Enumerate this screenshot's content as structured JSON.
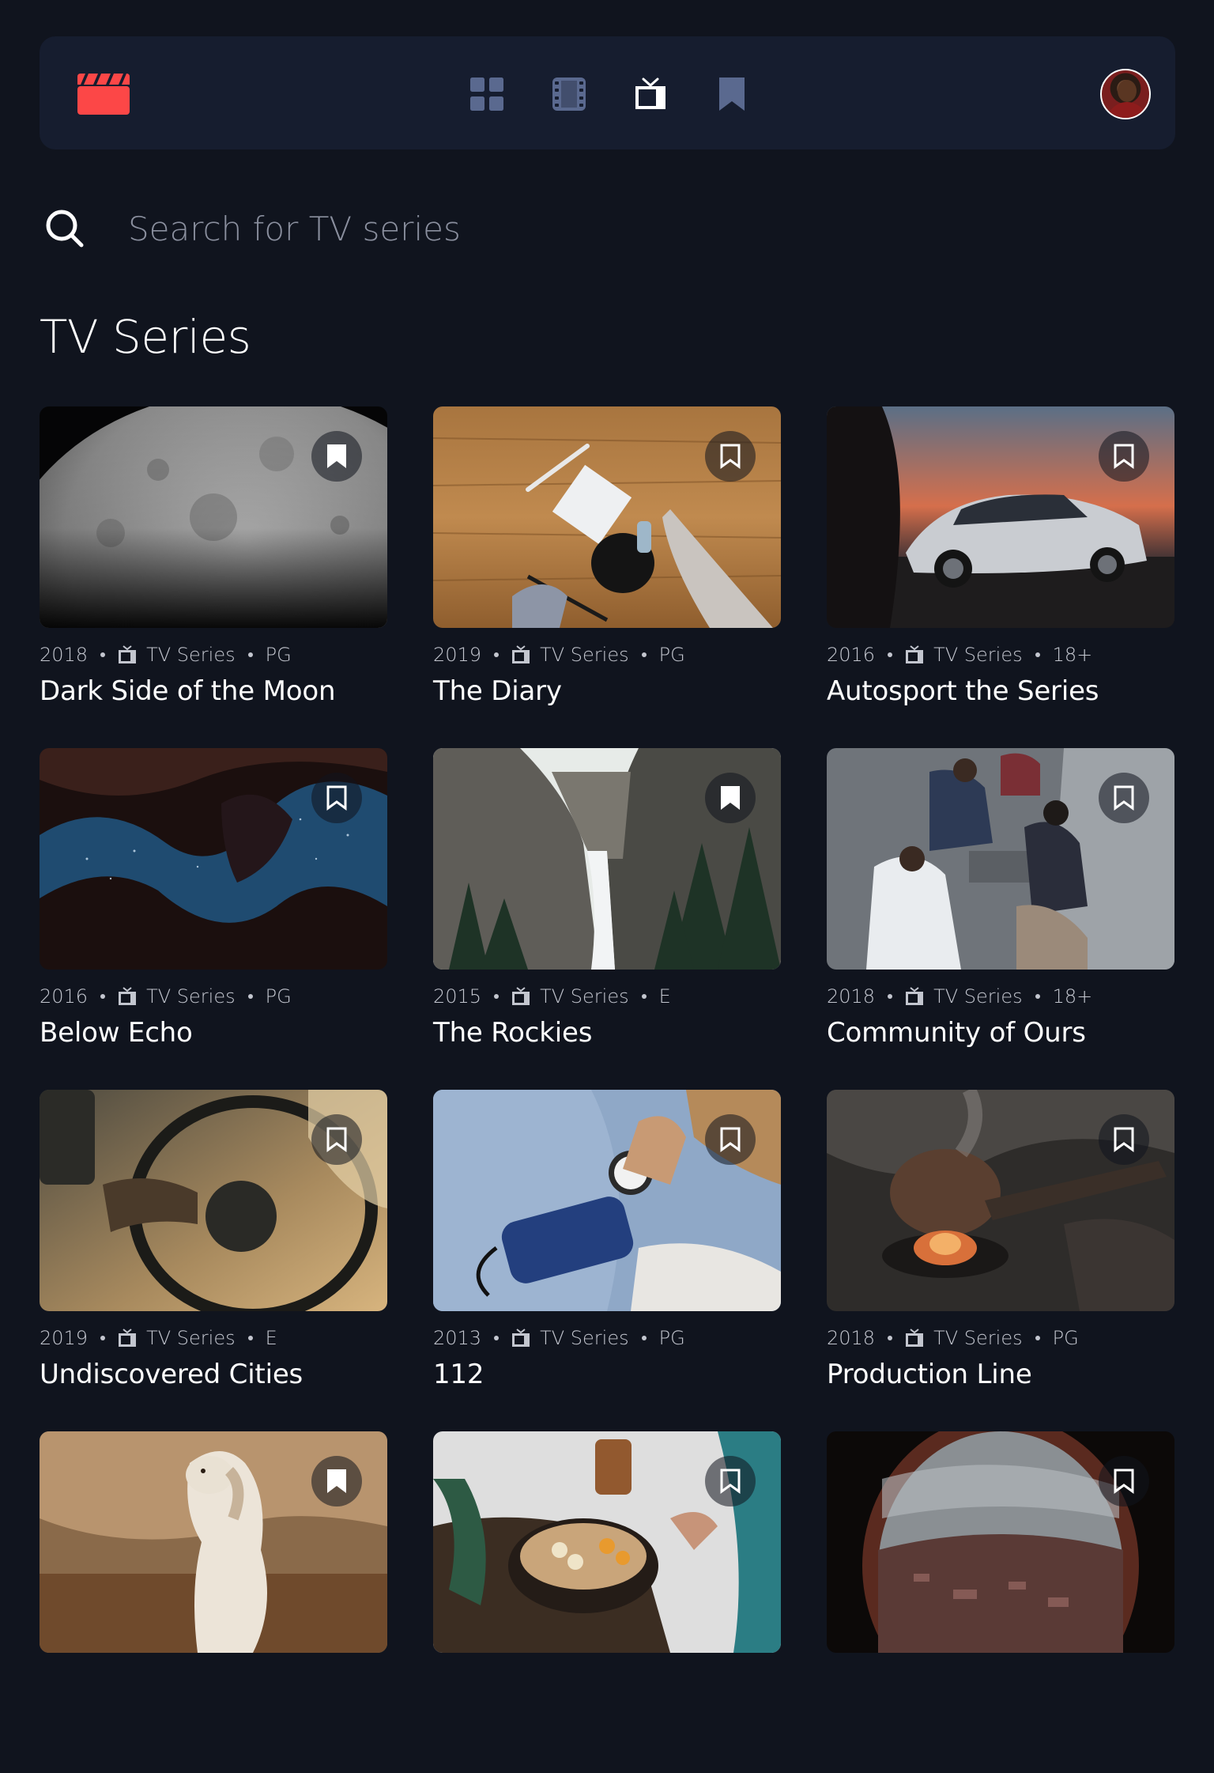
{
  "colors": {
    "background": "#10141e",
    "nav_background": "#161d2f",
    "accent_red": "#fc4747",
    "nav_icon_inactive": "#5a698f",
    "nav_icon_active": "#ffffff",
    "muted_text": "#c3c6cf"
  },
  "nav": {
    "logo_icon": "clapperboard-icon",
    "items": [
      {
        "name": "home",
        "icon": "grid-icon",
        "active": false
      },
      {
        "name": "movies",
        "icon": "film-icon",
        "active": false
      },
      {
        "name": "tv-series",
        "icon": "tv-icon",
        "active": true
      },
      {
        "name": "bookmarks",
        "icon": "bookmark-icon",
        "active": false
      }
    ],
    "avatar_icon": "user-avatar"
  },
  "search": {
    "icon": "search-icon",
    "placeholder": "Search for TV series",
    "value": ""
  },
  "page_title": "TV Series",
  "items": [
    {
      "year": "2018",
      "category": "TV Series",
      "rating": "PG",
      "title": "Dark Side of the Moon",
      "bookmarked": true
    },
    {
      "year": "2019",
      "category": "TV Series",
      "rating": "PG",
      "title": "The Diary",
      "bookmarked": false
    },
    {
      "year": "2016",
      "category": "TV Series",
      "rating": "18+",
      "title": "Autosport the Series",
      "bookmarked": false
    },
    {
      "year": "2016",
      "category": "TV Series",
      "rating": "PG",
      "title": "Below Echo",
      "bookmarked": false
    },
    {
      "year": "2015",
      "category": "TV Series",
      "rating": "E",
      "title": "The Rockies",
      "bookmarked": true
    },
    {
      "year": "2018",
      "category": "TV Series",
      "rating": "18+",
      "title": "Community of Ours",
      "bookmarked": false
    },
    {
      "year": "2019",
      "category": "TV Series",
      "rating": "E",
      "title": "Undiscovered Cities",
      "bookmarked": false
    },
    {
      "year": "2013",
      "category": "TV Series",
      "rating": "PG",
      "title": "112",
      "bookmarked": false
    },
    {
      "year": "2018",
      "category": "TV Series",
      "rating": "PG",
      "title": "Production Line",
      "bookmarked": false
    },
    {
      "year": "",
      "category": "",
      "rating": "",
      "title": "",
      "bookmarked": true
    },
    {
      "year": "",
      "category": "",
      "rating": "",
      "title": "",
      "bookmarked": false
    },
    {
      "year": "",
      "category": "",
      "rating": "",
      "title": "",
      "bookmarked": false
    }
  ]
}
